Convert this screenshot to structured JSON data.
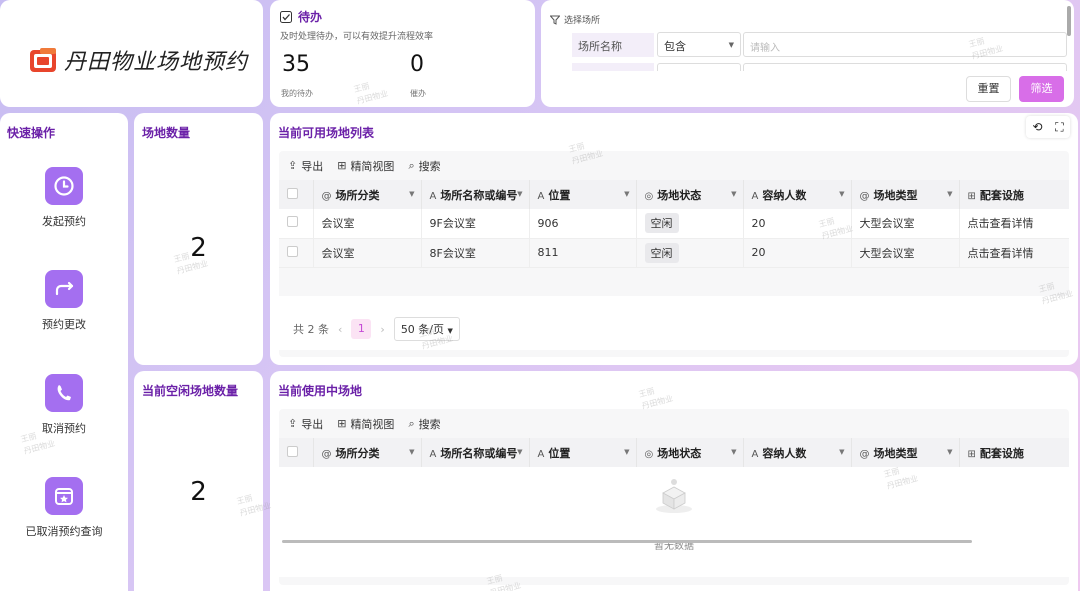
{
  "logo": {
    "text": "丹田物业场地预约"
  },
  "todo": {
    "title": "待办",
    "subtitle": "及时处理待办，可以有效提升流程效率",
    "my_todo_count": "35",
    "my_todo_label": "我的待办",
    "urge_count": "0",
    "urge_label": "催办"
  },
  "filter": {
    "title": "选择场所",
    "field_label": "场所名称",
    "operator": "包含",
    "input_placeholder": "请输入",
    "reset_label": "重置",
    "filter_label": "筛选"
  },
  "quick_ops": {
    "title": "快速操作",
    "items": [
      {
        "label": "发起预约",
        "icon": "clock-icon"
      },
      {
        "label": "预约更改",
        "icon": "swap-arrow-icon"
      },
      {
        "label": "取消预约",
        "icon": "phone-icon"
      },
      {
        "label": "已取消预约查询",
        "icon": "calendar-star-icon"
      }
    ]
  },
  "venue_count": {
    "title": "场地数量",
    "value": "2"
  },
  "free_count": {
    "title": "当前空闲场地数量",
    "value": "2"
  },
  "available_table": {
    "title": "当前可用场地列表",
    "toolbar": {
      "export": "导出",
      "view": "精简视图",
      "search": "搜索"
    },
    "columns": [
      "场所分类",
      "场所名称或编号",
      "位置",
      "场地状态",
      "容纳人数",
      "场地类型",
      "配套设施"
    ],
    "rows": [
      {
        "category": "会议室",
        "name": "9F会议室",
        "location": "906",
        "status": "空闲",
        "capacity": "20",
        "type": "大型会议室",
        "facility": "点击查看详情"
      },
      {
        "category": "会议室",
        "name": "8F会议室",
        "location": "811",
        "status": "空闲",
        "capacity": "20",
        "type": "大型会议室",
        "facility": "点击查看详情"
      }
    ],
    "pager": {
      "total": "共 2 条",
      "current_page": "1",
      "page_size": "50 条/页"
    }
  },
  "inuse_table": {
    "title": "当前使用中场地",
    "toolbar": {
      "export": "导出",
      "view": "精简视图",
      "search": "搜索"
    },
    "columns": [
      "场所分类",
      "场所名称或编号",
      "位置",
      "场地状态",
      "容纳人数",
      "场地类型",
      "配套设施"
    ],
    "empty_text": "暂无数据"
  },
  "watermark": {
    "line1": "王丽",
    "line2": "丹田物业"
  },
  "colors": {
    "accent": "#6b21a8",
    "primary_button": "#d86ee8",
    "icon_bg": "#a46ff0"
  }
}
